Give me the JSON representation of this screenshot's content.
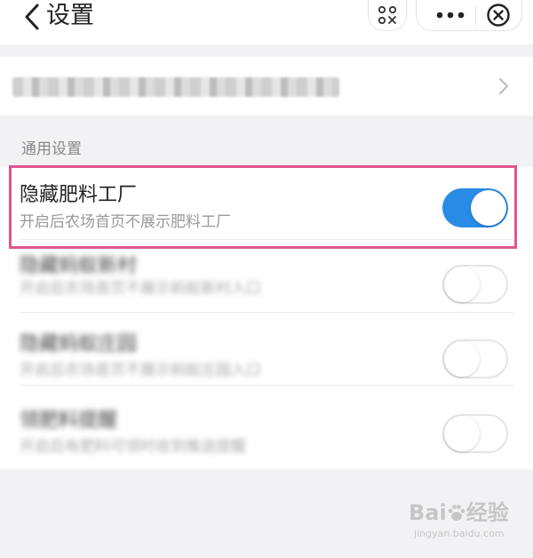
{
  "nav": {
    "title": "设置",
    "icons": [
      "chevron-left-icon",
      "scan-icon",
      "more-icon",
      "close-circle-icon"
    ]
  },
  "account": {
    "text": "",
    "icon": "chevron-right-icon"
  },
  "section": {
    "label": "通用设置"
  },
  "settings": [
    {
      "title": "隐藏肥料工厂",
      "desc": "开启后农场首页不展示肥料工厂",
      "enabled": true
    },
    {
      "title": "隐藏蚂蚁新村",
      "desc": "开启后农场首页不展示蚂蚁新村入口",
      "enabled": false
    },
    {
      "title": "隐藏蚂蚁庄园",
      "desc": "开启后农场首页不展示蚂蚁庄园入口",
      "enabled": false
    },
    {
      "title": "领肥料提醒",
      "desc": "开启后有肥料可领时收到推送提醒",
      "enabled": false
    }
  ],
  "colors": {
    "toggle_on": "#2a8be6",
    "highlight": "#e0568f"
  },
  "watermark": {
    "brand": "Bai",
    "suffix": "经验",
    "url": "jingyan.baidu.com"
  }
}
